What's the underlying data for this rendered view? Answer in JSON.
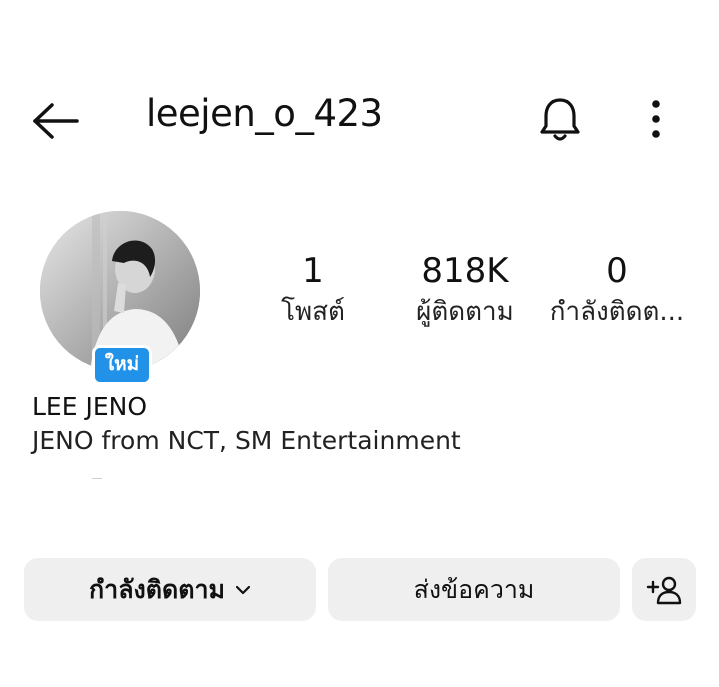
{
  "header": {
    "username": "leejen_o_423",
    "icons": {
      "back": "arrow-left-icon",
      "bell": "bell-icon",
      "more": "more-vertical-icon"
    }
  },
  "profile": {
    "avatar_badge": "ใหม่",
    "stats": [
      {
        "value": "1",
        "label": "โพสต์"
      },
      {
        "value": "818K",
        "label": "ผู้ติดตาม"
      },
      {
        "value": "0",
        "label": "กำลังติดต..."
      }
    ],
    "full_name": "LEE JENO",
    "bio": "JENO from NCT, SM Entertainment"
  },
  "actions": {
    "following_label": "กำลังติดตาม",
    "message_label": "ส่งข้อความ",
    "icons": {
      "following_chevron": "chevron-down-icon",
      "add_user": "add-user-icon"
    }
  },
  "colors": {
    "badge": "#2192e8",
    "button_bg": "#efefef",
    "text": "#111111"
  }
}
